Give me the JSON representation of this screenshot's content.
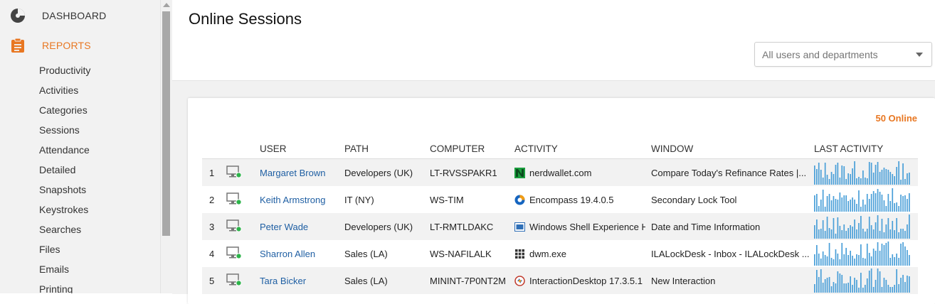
{
  "sidebar": {
    "dashboard_label": "DASHBOARD",
    "reports_label": "REPORTS",
    "items": [
      {
        "label": "Productivity"
      },
      {
        "label": "Activities"
      },
      {
        "label": "Categories"
      },
      {
        "label": "Sessions"
      },
      {
        "label": "Attendance"
      },
      {
        "label": "Detailed"
      },
      {
        "label": "Snapshots"
      },
      {
        "label": "Keystrokes"
      },
      {
        "label": "Searches"
      },
      {
        "label": "Files"
      },
      {
        "label": "Emails"
      },
      {
        "label": "Printing"
      }
    ]
  },
  "header": {
    "title": "Online Sessions",
    "filter_placeholder": "All users and departments"
  },
  "summary": {
    "online_count": "50 Online"
  },
  "table": {
    "columns": [
      "USER",
      "PATH",
      "COMPUTER",
      "ACTIVITY",
      "WINDOW",
      "LAST ACTIVITY"
    ],
    "rows": [
      {
        "num": "1",
        "user": "Margaret Brown",
        "path": "Developers (UK)",
        "computer": "LT-RVSSPAKR1",
        "activity": "nerdwallet.com",
        "activity_icon": "nerdwallet-icon",
        "window": "Compare Today's Refinance Rates |..."
      },
      {
        "num": "2",
        "user": "Keith Armstrong",
        "path": "IT (NY)",
        "computer": "WS-TIM",
        "activity": "Encompass 19.4.0.5",
        "activity_icon": "encompass-icon",
        "window": "Secondary Lock Tool"
      },
      {
        "num": "3",
        "user": "Peter Wade",
        "path": "Developers (UK)",
        "computer": "LT-RMTLDAKC",
        "activity": "Windows Shell Experience H",
        "activity_icon": "windows-shell-icon",
        "window": "Date and Time Information"
      },
      {
        "num": "4",
        "user": "Sharron Allen",
        "path": "Sales (LA)",
        "computer": "WS-NAFILALK",
        "activity": "dwm.exe",
        "activity_icon": "dwm-grid-icon",
        "window": "ILALockDesk - Inbox - ILALockDesk ..."
      },
      {
        "num": "5",
        "user": "Tara Bicker",
        "path": "Sales (LA)",
        "computer": "MININT-7P0NT2M",
        "activity": "InteractionDesktop 17.3.5.1",
        "activity_icon": "interaction-desktop-icon",
        "window": "New Interaction"
      }
    ]
  },
  "colors": {
    "accent": "#e87722",
    "link": "#1f5fa3",
    "spark": "#4a9fd8",
    "online_dot": "#2db34a"
  }
}
